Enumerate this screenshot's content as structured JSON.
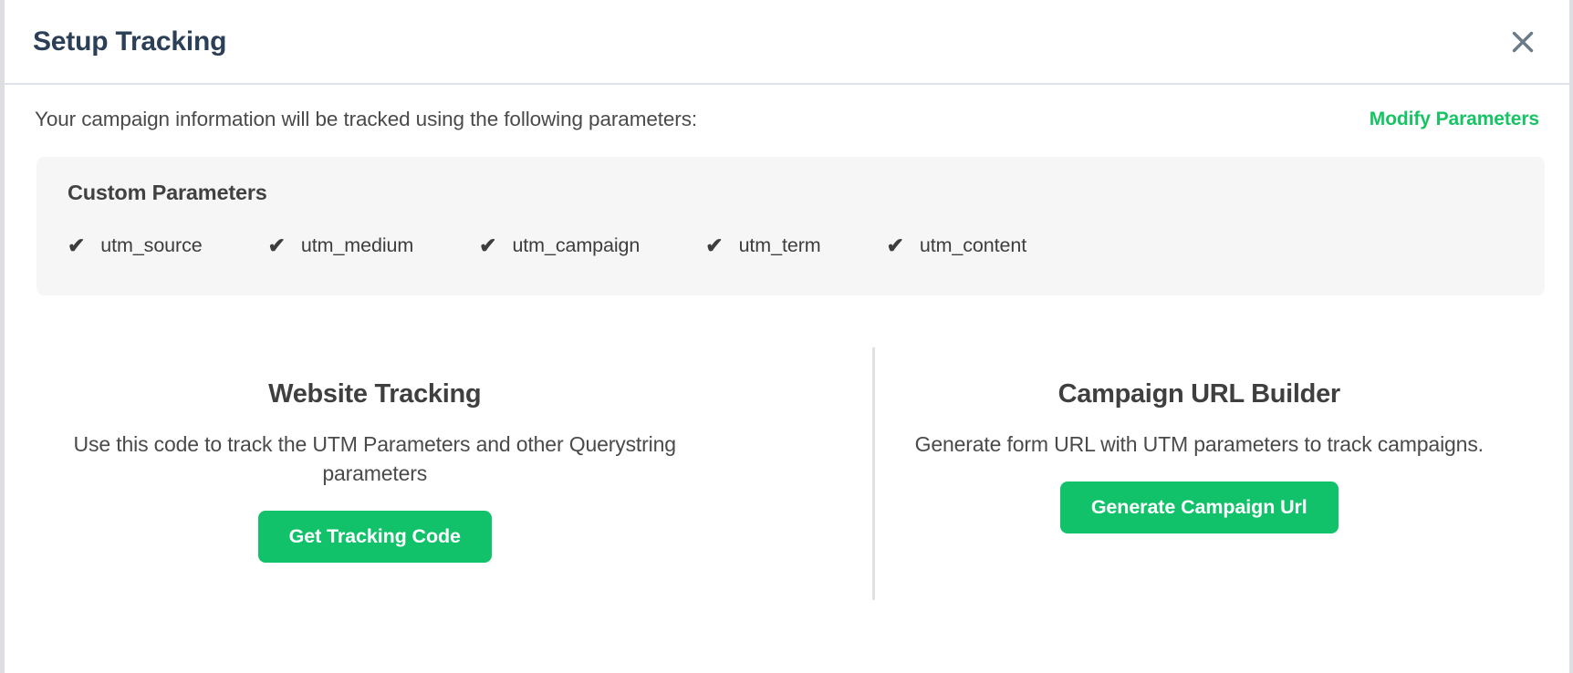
{
  "header": {
    "title": "Setup Tracking",
    "close_icon": "close-icon"
  },
  "intro": {
    "text": "Your campaign information will be tracked using the following parameters:",
    "modify_link": "Modify Parameters"
  },
  "parameters_panel": {
    "title": "Custom Parameters",
    "check_glyph": "✔",
    "items": [
      {
        "label": "utm_source"
      },
      {
        "label": "utm_medium"
      },
      {
        "label": "utm_campaign"
      },
      {
        "label": "utm_term"
      },
      {
        "label": "utm_content"
      }
    ]
  },
  "columns": [
    {
      "title": "Website Tracking",
      "description": "Use this code to track the UTM Parameters and other Querystring parameters",
      "button_label": "Get Tracking Code"
    },
    {
      "title": "Campaign URL Builder",
      "description": "Generate form URL with UTM parameters to track campaigns.",
      "button_label": "Generate Campaign Url"
    }
  ],
  "colors": {
    "accent_green": "#12c26a",
    "link_green": "#16c464",
    "title_navy": "#2b3f56",
    "panel_gray": "#f6f6f6",
    "close_icon_gray": "#6b7b88"
  }
}
